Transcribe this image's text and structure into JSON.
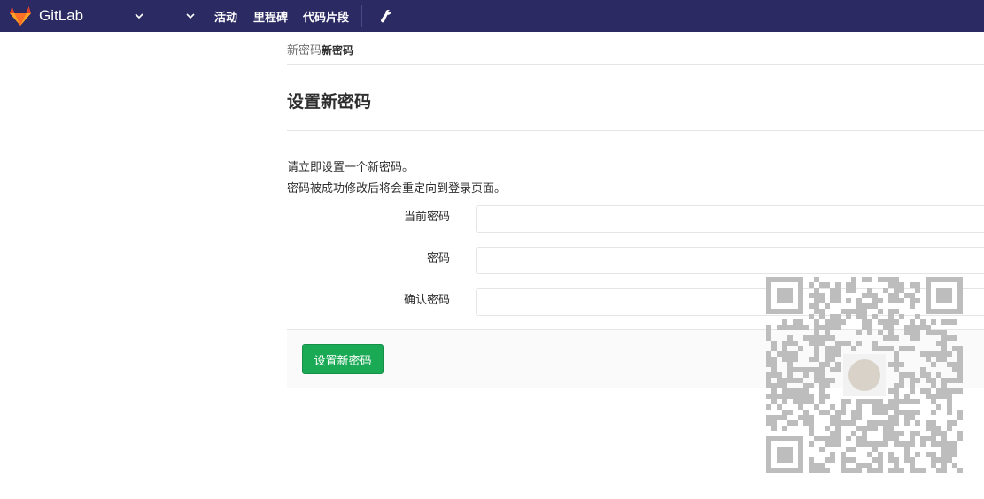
{
  "navbar": {
    "brand": "GitLab",
    "links": [
      "活动",
      "里程碑",
      "代码片段"
    ],
    "colors": {
      "background": "#2b2a63",
      "logo_orange": "#e24329"
    }
  },
  "breadcrumb": {
    "parent": "新密码",
    "current": "新密码"
  },
  "page": {
    "title": "设置新密码",
    "info_line1": "请立即设置一个新密码。",
    "info_line2": "密码被成功修改后将会重定向到登录页面。"
  },
  "form": {
    "current_password_label": "当前密码",
    "password_label": "密码",
    "confirm_password_label": "确认密码",
    "submit_label": "设置新密码"
  },
  "colors": {
    "primary_button": "#1aaa55",
    "qr_modules": "#bdbdbd"
  }
}
